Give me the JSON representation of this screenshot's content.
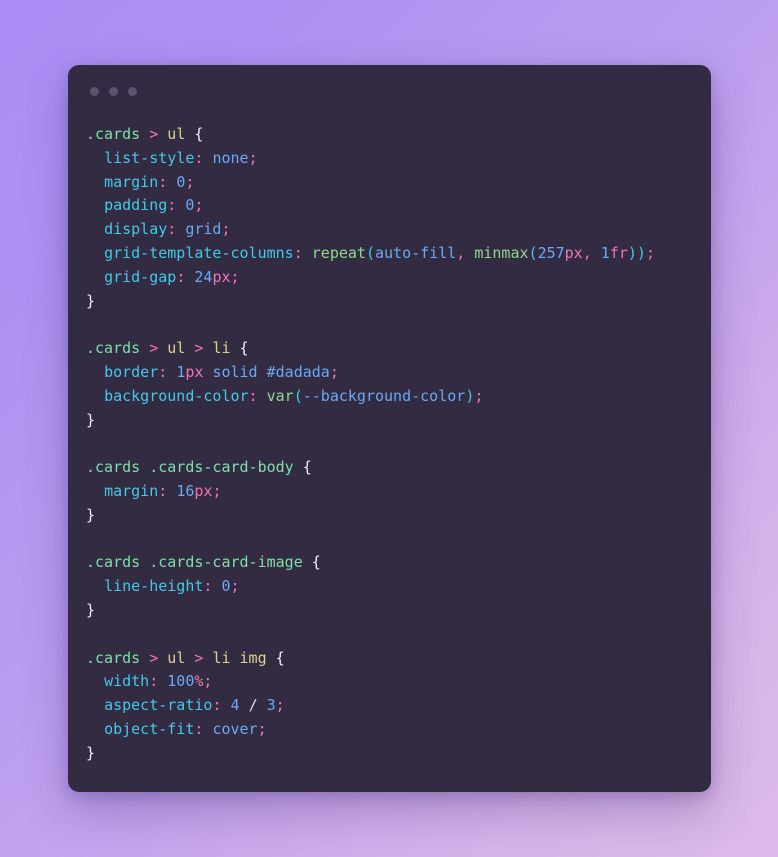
{
  "window": {
    "traffic_lights": [
      "close-dot",
      "minimize-dot",
      "maximize-dot"
    ],
    "background_color": "#322b42",
    "page_gradient_from": "#a98cf5",
    "page_gradient_to": "#ddbaea"
  },
  "code": {
    "language": "css",
    "lines": [
      {
        "type": "code",
        "tokens": [
          {
            "t": ".cards",
            "c": "t-sel"
          },
          {
            "t": " ",
            "c": ""
          },
          {
            "t": ">",
            "c": "t-comb"
          },
          {
            "t": " ",
            "c": ""
          },
          {
            "t": "ul",
            "c": "t-tag"
          },
          {
            "t": " ",
            "c": ""
          },
          {
            "t": "{",
            "c": "t-brace"
          }
        ]
      },
      {
        "type": "code",
        "tokens": [
          {
            "t": "  ",
            "c": ""
          },
          {
            "t": "list-style",
            "c": "t-prop"
          },
          {
            "t": ":",
            "c": "t-punc"
          },
          {
            "t": " ",
            "c": ""
          },
          {
            "t": "none",
            "c": "t-val"
          },
          {
            "t": ";",
            "c": "t-punc"
          }
        ]
      },
      {
        "type": "code",
        "tokens": [
          {
            "t": "  ",
            "c": ""
          },
          {
            "t": "margin",
            "c": "t-prop"
          },
          {
            "t": ":",
            "c": "t-punc"
          },
          {
            "t": " ",
            "c": ""
          },
          {
            "t": "0",
            "c": "t-num"
          },
          {
            "t": ";",
            "c": "t-punc"
          }
        ]
      },
      {
        "type": "code",
        "tokens": [
          {
            "t": "  ",
            "c": ""
          },
          {
            "t": "padding",
            "c": "t-prop"
          },
          {
            "t": ":",
            "c": "t-punc"
          },
          {
            "t": " ",
            "c": ""
          },
          {
            "t": "0",
            "c": "t-num"
          },
          {
            "t": ";",
            "c": "t-punc"
          }
        ]
      },
      {
        "type": "code",
        "tokens": [
          {
            "t": "  ",
            "c": ""
          },
          {
            "t": "display",
            "c": "t-prop"
          },
          {
            "t": ":",
            "c": "t-punc"
          },
          {
            "t": " ",
            "c": ""
          },
          {
            "t": "grid",
            "c": "t-val"
          },
          {
            "t": ";",
            "c": "t-punc"
          }
        ]
      },
      {
        "type": "code",
        "tokens": [
          {
            "t": "  ",
            "c": ""
          },
          {
            "t": "grid-template-columns",
            "c": "t-prop"
          },
          {
            "t": ":",
            "c": "t-punc"
          },
          {
            "t": " ",
            "c": ""
          },
          {
            "t": "repeat",
            "c": "t-func"
          },
          {
            "t": "(",
            "c": "t-paren"
          },
          {
            "t": "auto-fill",
            "c": "t-val"
          },
          {
            "t": ",",
            "c": "t-punc"
          },
          {
            "t": " ",
            "c": ""
          },
          {
            "t": "minmax",
            "c": "t-func"
          },
          {
            "t": "(",
            "c": "t-paren"
          },
          {
            "t": "257",
            "c": "t-num"
          },
          {
            "t": "px",
            "c": "t-unit"
          },
          {
            "t": ",",
            "c": "t-punc"
          },
          {
            "t": " ",
            "c": ""
          },
          {
            "t": "1",
            "c": "t-num"
          },
          {
            "t": "fr",
            "c": "t-unit"
          },
          {
            "t": "))",
            "c": "t-paren"
          },
          {
            "t": ";",
            "c": "t-punc"
          }
        ]
      },
      {
        "type": "code",
        "tokens": [
          {
            "t": "  ",
            "c": ""
          },
          {
            "t": "grid-gap",
            "c": "t-prop"
          },
          {
            "t": ":",
            "c": "t-punc"
          },
          {
            "t": " ",
            "c": ""
          },
          {
            "t": "24",
            "c": "t-num"
          },
          {
            "t": "px",
            "c": "t-unit"
          },
          {
            "t": ";",
            "c": "t-punc"
          }
        ]
      },
      {
        "type": "code",
        "tokens": [
          {
            "t": "}",
            "c": "t-brace"
          }
        ]
      },
      {
        "type": "blank",
        "tokens": []
      },
      {
        "type": "code",
        "tokens": [
          {
            "t": ".cards",
            "c": "t-sel"
          },
          {
            "t": " ",
            "c": ""
          },
          {
            "t": ">",
            "c": "t-comb"
          },
          {
            "t": " ",
            "c": ""
          },
          {
            "t": "ul",
            "c": "t-tag"
          },
          {
            "t": " ",
            "c": ""
          },
          {
            "t": ">",
            "c": "t-comb"
          },
          {
            "t": " ",
            "c": ""
          },
          {
            "t": "li",
            "c": "t-tag"
          },
          {
            "t": " ",
            "c": ""
          },
          {
            "t": "{",
            "c": "t-brace"
          }
        ]
      },
      {
        "type": "code",
        "tokens": [
          {
            "t": "  ",
            "c": ""
          },
          {
            "t": "border",
            "c": "t-prop"
          },
          {
            "t": ":",
            "c": "t-punc"
          },
          {
            "t": " ",
            "c": ""
          },
          {
            "t": "1",
            "c": "t-num"
          },
          {
            "t": "px",
            "c": "t-unit"
          },
          {
            "t": " ",
            "c": ""
          },
          {
            "t": "solid",
            "c": "t-val"
          },
          {
            "t": " ",
            "c": ""
          },
          {
            "t": "#dadada",
            "c": "t-val"
          },
          {
            "t": ";",
            "c": "t-punc"
          }
        ]
      },
      {
        "type": "code",
        "tokens": [
          {
            "t": "  ",
            "c": ""
          },
          {
            "t": "background-color",
            "c": "t-prop"
          },
          {
            "t": ":",
            "c": "t-punc"
          },
          {
            "t": " ",
            "c": ""
          },
          {
            "t": "var",
            "c": "t-func"
          },
          {
            "t": "(",
            "c": "t-paren"
          },
          {
            "t": "--background-color",
            "c": "t-val"
          },
          {
            "t": ")",
            "c": "t-paren"
          },
          {
            "t": ";",
            "c": "t-punc"
          }
        ]
      },
      {
        "type": "code",
        "tokens": [
          {
            "t": "}",
            "c": "t-brace"
          }
        ]
      },
      {
        "type": "blank",
        "tokens": []
      },
      {
        "type": "code",
        "tokens": [
          {
            "t": ".cards",
            "c": "t-sel"
          },
          {
            "t": " ",
            "c": ""
          },
          {
            "t": ".cards-card-body",
            "c": "t-sel"
          },
          {
            "t": " ",
            "c": ""
          },
          {
            "t": "{",
            "c": "t-brace"
          }
        ]
      },
      {
        "type": "code",
        "tokens": [
          {
            "t": "  ",
            "c": ""
          },
          {
            "t": "margin",
            "c": "t-prop"
          },
          {
            "t": ":",
            "c": "t-punc"
          },
          {
            "t": " ",
            "c": ""
          },
          {
            "t": "16",
            "c": "t-num"
          },
          {
            "t": "px",
            "c": "t-unit"
          },
          {
            "t": ";",
            "c": "t-punc"
          }
        ]
      },
      {
        "type": "code",
        "tokens": [
          {
            "t": "}",
            "c": "t-brace"
          }
        ]
      },
      {
        "type": "blank",
        "tokens": []
      },
      {
        "type": "code",
        "tokens": [
          {
            "t": ".cards",
            "c": "t-sel"
          },
          {
            "t": " ",
            "c": ""
          },
          {
            "t": ".cards-card-image",
            "c": "t-sel"
          },
          {
            "t": " ",
            "c": ""
          },
          {
            "t": "{",
            "c": "t-brace"
          }
        ]
      },
      {
        "type": "code",
        "tokens": [
          {
            "t": "  ",
            "c": ""
          },
          {
            "t": "line-height",
            "c": "t-prop"
          },
          {
            "t": ":",
            "c": "t-punc"
          },
          {
            "t": " ",
            "c": ""
          },
          {
            "t": "0",
            "c": "t-num"
          },
          {
            "t": ";",
            "c": "t-punc"
          }
        ]
      },
      {
        "type": "code",
        "tokens": [
          {
            "t": "}",
            "c": "t-brace"
          }
        ]
      },
      {
        "type": "blank",
        "tokens": []
      },
      {
        "type": "code",
        "tokens": [
          {
            "t": ".cards",
            "c": "t-sel"
          },
          {
            "t": " ",
            "c": ""
          },
          {
            "t": ">",
            "c": "t-comb"
          },
          {
            "t": " ",
            "c": ""
          },
          {
            "t": "ul",
            "c": "t-tag"
          },
          {
            "t": " ",
            "c": ""
          },
          {
            "t": ">",
            "c": "t-comb"
          },
          {
            "t": " ",
            "c": ""
          },
          {
            "t": "li",
            "c": "t-tag"
          },
          {
            "t": " ",
            "c": ""
          },
          {
            "t": "img",
            "c": "t-tag"
          },
          {
            "t": " ",
            "c": ""
          },
          {
            "t": "{",
            "c": "t-brace"
          }
        ]
      },
      {
        "type": "code",
        "tokens": [
          {
            "t": "  ",
            "c": ""
          },
          {
            "t": "width",
            "c": "t-prop"
          },
          {
            "t": ":",
            "c": "t-punc"
          },
          {
            "t": " ",
            "c": ""
          },
          {
            "t": "100",
            "c": "t-num"
          },
          {
            "t": "%",
            "c": "t-unit"
          },
          {
            "t": ";",
            "c": "t-punc"
          }
        ]
      },
      {
        "type": "code",
        "tokens": [
          {
            "t": "  ",
            "c": ""
          },
          {
            "t": "aspect-ratio",
            "c": "t-prop"
          },
          {
            "t": ":",
            "c": "t-punc"
          },
          {
            "t": " ",
            "c": ""
          },
          {
            "t": "4",
            "c": "t-num"
          },
          {
            "t": " ",
            "c": ""
          },
          {
            "t": "/",
            "c": "t-slash"
          },
          {
            "t": " ",
            "c": ""
          },
          {
            "t": "3",
            "c": "t-num"
          },
          {
            "t": ";",
            "c": "t-punc"
          }
        ]
      },
      {
        "type": "code",
        "tokens": [
          {
            "t": "  ",
            "c": ""
          },
          {
            "t": "object-fit",
            "c": "t-prop"
          },
          {
            "t": ":",
            "c": "t-punc"
          },
          {
            "t": " ",
            "c": ""
          },
          {
            "t": "cover",
            "c": "t-val"
          },
          {
            "t": ";",
            "c": "t-punc"
          }
        ]
      },
      {
        "type": "code",
        "tokens": [
          {
            "t": "}",
            "c": "t-brace"
          }
        ]
      }
    ]
  }
}
